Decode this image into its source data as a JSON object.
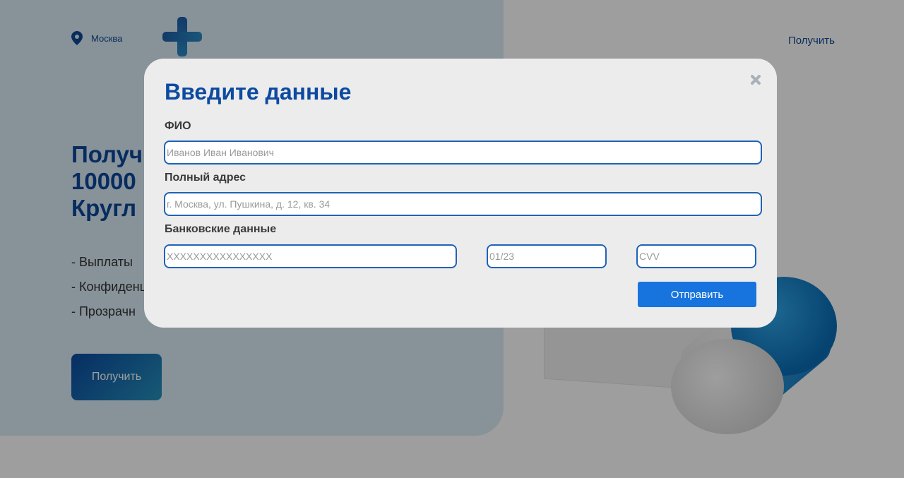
{
  "header": {
    "location": "Москва",
    "nav_link": "Получить"
  },
  "hero": {
    "title_lines": [
      "Получ",
      "10000",
      "Кругл"
    ],
    "features": [
      "- Выплаты",
      "- Конфиденц",
      "- Прозрачн"
    ],
    "button_label": "Получить"
  },
  "modal": {
    "title": "Введите данные",
    "fio": {
      "label": "ФИО",
      "placeholder": "Иванов Иван Иванович"
    },
    "address": {
      "label": "Полный адрес",
      "placeholder": "г. Москва, ул. Пушкина, д. 12, кв. 34"
    },
    "bank": {
      "label": "Банковские данные",
      "card_placeholder": "XXXXXXXXXXXXXXXX",
      "expiry_placeholder": "01/23",
      "cvv_placeholder": "CVV"
    },
    "submit_label": "Отправить"
  },
  "colors": {
    "accent": "#0d4aa0",
    "button": "#1774de",
    "input_border": "#1f63b5",
    "hero_panel": "#dbecf7"
  }
}
